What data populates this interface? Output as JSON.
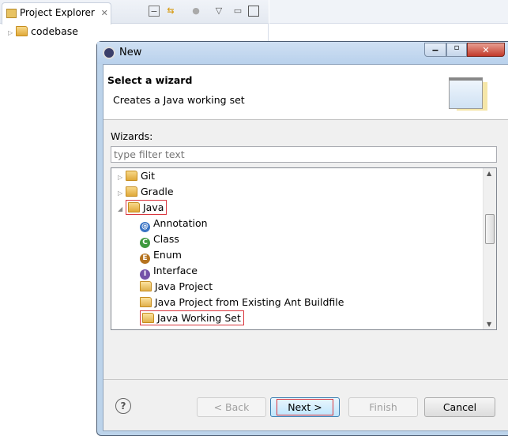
{
  "explorer": {
    "tab_label": "Project Explorer",
    "close": "✕",
    "items": [
      {
        "label": "codebase"
      }
    ]
  },
  "dialog": {
    "title": "New",
    "header_title": "Select a wizard",
    "header_desc": "Creates a Java working set",
    "wizards_label": "Wizards:",
    "filter_placeholder": "type filter text",
    "tree": [
      {
        "label": "Git",
        "type": "folder",
        "level": 0,
        "expanded": false
      },
      {
        "label": "Gradle",
        "type": "folder",
        "level": 0,
        "expanded": false
      },
      {
        "label": "Java",
        "type": "folder",
        "level": 0,
        "expanded": true,
        "highlighted": true
      },
      {
        "label": "Annotation",
        "type": "annotation",
        "level": 1
      },
      {
        "label": "Class",
        "type": "class",
        "level": 1
      },
      {
        "label": "Enum",
        "type": "enum",
        "level": 1
      },
      {
        "label": "Interface",
        "type": "interface",
        "level": 1
      },
      {
        "label": "Java Project",
        "type": "project",
        "level": 1
      },
      {
        "label": "Java Project from Existing Ant Buildfile",
        "type": "ant",
        "level": 1
      },
      {
        "label": "Java Working Set",
        "type": "workingset",
        "level": 1,
        "highlighted": true
      }
    ],
    "buttons": {
      "back": "< Back",
      "next": "Next >",
      "finish": "Finish",
      "cancel": "Cancel",
      "help": "?"
    }
  },
  "colors": {
    "highlight": "#d9363e",
    "focus": "#3c7fb1"
  }
}
